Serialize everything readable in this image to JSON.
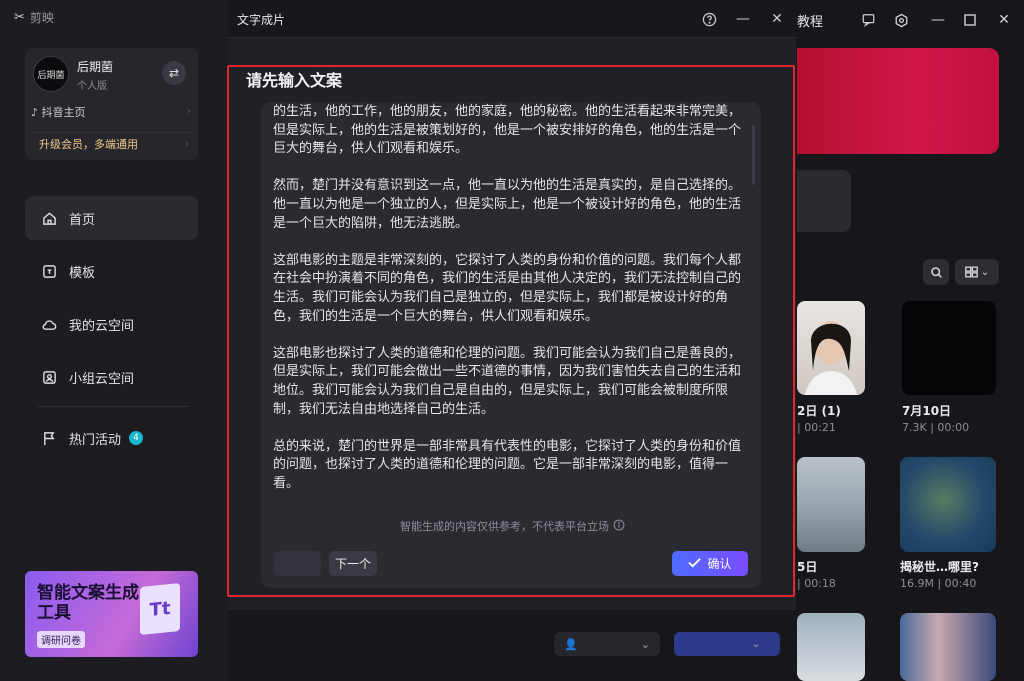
{
  "app": {
    "brand": "剪映"
  },
  "user": {
    "avatar_text": "后期菌",
    "name": "后期菌",
    "tier": "个人版",
    "douyin_label": "抖音主页",
    "upgrade_label": "升级会员，多端通用"
  },
  "nav": [
    {
      "label": "首页",
      "icon": "home-icon"
    },
    {
      "label": "模板",
      "icon": "template-icon"
    },
    {
      "label": "我的云空间",
      "icon": "cloud-icon"
    },
    {
      "label": "小组云空间",
      "icon": "group-cloud-icon"
    },
    {
      "label": "热门活动",
      "icon": "flag-icon",
      "badge": "4"
    }
  ],
  "promo": {
    "title": "智能文案生成工具",
    "subtitle": "调研问卷",
    "glyph": "Tt"
  },
  "topbar": {
    "tutorial": "教程"
  },
  "videos": [
    {
      "title": "2日 (1)",
      "meta": "| 00:21"
    },
    {
      "title": "7月10日",
      "meta": "7.3K | 00:00"
    },
    {
      "title": "5日",
      "meta": "| 00:18"
    },
    {
      "title": "揭秘世…哪里?",
      "meta": "16.9M | 00:40"
    }
  ],
  "dialog": {
    "title": "文字成片",
    "prompt": "请先输入文案",
    "paragraphs": [
      "的生活，他的工作，他的朋友，他的家庭，他的秘密。他的生活看起来非常完美，但是实际上，他的生活是被策划好的，他是一个被安排好的角色，他的生活是一个巨大的舞台，供人们观看和娱乐。",
      "然而，楚门并没有意识到这一点，他一直以为他的生活是真实的，是自己选择的。他一直以为他是一个独立的人，但是实际上，他是一个被设计好的角色，他的生活是一个巨大的陷阱，他无法逃脱。",
      "这部电影的主题是非常深刻的，它探讨了人类的身份和价值的问题。我们每个人都在社会中扮演着不同的角色，我们的生活是由其他人决定的，我们无法控制自己的生活。我们可能会认为我们自己是独立的，但是实际上，我们都是被设计好的角色，我们的生活是一个巨大的舞台，供人们观看和娱乐。",
      "这部电影也探讨了人类的道德和伦理的问题。我们可能会认为我们自己是善良的，但是实际上，我们可能会做出一些不道德的事情，因为我们害怕失去自己的生活和地位。我们可能会认为我们自己是自由的，但是实际上，我们可能会被制度所限制，我们无法自由地选择自己的生活。",
      "总的来说，楚门的世界是一部非常具有代表性的电影，它探讨了人类的身份和价值的问题，也探讨了人类的道德和伦理的问题。它是一部非常深刻的电影，值得一看。"
    ],
    "disclaimer": "智能生成的内容仅供参考，不代表平台立场",
    "next_label": "下一个",
    "confirm_label": "确认"
  },
  "colors": {
    "frame": "#e0252b",
    "confirm_start": "#4d6bff",
    "confirm_end": "#7b4dff",
    "banner": "#c8123f",
    "badge": "#18b6c8"
  }
}
